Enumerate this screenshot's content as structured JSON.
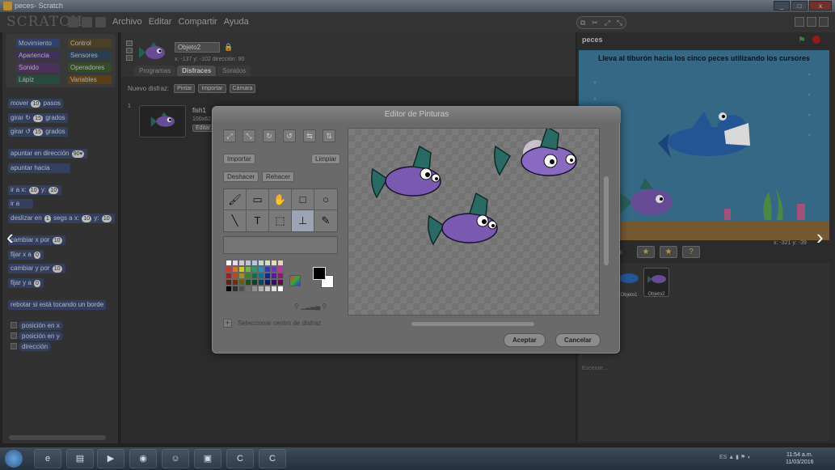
{
  "window": {
    "title": "peces- Scratch",
    "controls": [
      "_",
      "□",
      "x"
    ]
  },
  "menubar": {
    "logo": "SCRATCH",
    "menus": [
      "Archivo",
      "Editar",
      "Compartir",
      "Ayuda"
    ]
  },
  "categories": [
    "Movimiento",
    "Control",
    "Apariencia",
    "Sensores",
    "Sonido",
    "Operadores",
    "Lápiz",
    "Variables"
  ],
  "blocks": [
    {
      "pre": "mover",
      "n1": "10",
      "post": "pasos"
    },
    {
      "pre": "girar ↻",
      "n1": "15",
      "post": "grados"
    },
    {
      "pre": "girar ↺",
      "n1": "15",
      "post": "grados"
    },
    {
      "pre": "apuntar en dirección",
      "n1": "90▾",
      "post": ""
    },
    {
      "pre": "apuntar hacia",
      "n1": "",
      "post": ""
    },
    {
      "pre": "ir a x:",
      "n1": "10",
      "post": "y:",
      "n2": "10"
    },
    {
      "pre": "ir a",
      "n1": "",
      "post": ""
    },
    {
      "pre": "deslizar en",
      "n1": "1",
      "post": "segs a x:",
      "n2": "10",
      "post2": "y:",
      "n3": "10"
    },
    {
      "pre": "cambiar x por",
      "n1": "10",
      "post": ""
    },
    {
      "pre": "fijar x a",
      "n1": "0",
      "post": ""
    },
    {
      "pre": "cambiar y por",
      "n1": "10",
      "post": ""
    },
    {
      "pre": "fijar y a",
      "n1": "0",
      "post": ""
    },
    {
      "pre": "rebotar si está tocando un borde",
      "n1": "",
      "post": ""
    }
  ],
  "reporters": [
    "posición en x",
    "posición en y",
    "dirección"
  ],
  "sprite": {
    "name": "Objeto2",
    "pos": "x: -137  y: -102  dirección: 90"
  },
  "tabs": [
    "Programas",
    "Disfraces",
    "Sonidos"
  ],
  "costumes": {
    "new_label": "Nuevo disfraz:",
    "buttons": [
      "Pintar",
      "Importar",
      "Cámara"
    ],
    "index": "1",
    "name": "fish1",
    "dims": "100x62",
    "edit": "Editar"
  },
  "stage": {
    "project": "peces",
    "instruction": "Lleva al tiburón hacia los cinco peces utilizando los cursores",
    "coords": "x: -321  y: -39",
    "sprite_label": "to:",
    "sprites": [
      "Objeto1",
      "Objeto2"
    ],
    "stage_label": "Escenar..."
  },
  "paint_editor": {
    "title": "Editor de Pinturas",
    "import": "Importar",
    "clear": "Limpiar",
    "undo": "Deshacer",
    "redo": "Rehacer",
    "center_label": "Seleccionar centro de disfraz",
    "accept": "Aceptar",
    "cancel": "Cancelar",
    "top_tools": [
      "⤢",
      "⤡",
      "↻",
      "↺",
      "⇆",
      "⇅"
    ],
    "tools": [
      "🖌",
      "▭",
      "✋",
      "□",
      "○",
      "╲",
      "T",
      "⬚",
      "⊥",
      "✎"
    ],
    "palette": [
      "#ffffff",
      "#e8d8e8",
      "#d4c4dc",
      "#c0c0d8",
      "#b8c8d8",
      "#c0d8d0",
      "#d0e0c0",
      "#e0e0b8",
      "#e8d0c0",
      "#d83030",
      "#e07020",
      "#e0c020",
      "#60c030",
      "#20a060",
      "#2090c0",
      "#2040c0",
      "#7030c0",
      "#c030a0",
      "#a02020",
      "#b05020",
      "#a09020",
      "#408020",
      "#107040",
      "#107090",
      "#102890",
      "#502090",
      "#901870",
      "#602010",
      "#703010",
      "#606010",
      "#205010",
      "#104020",
      "#104060",
      "#101860",
      "#301060",
      "#600840",
      "#000000",
      "#303030",
      "#505050",
      "#707070",
      "#909090",
      "#b0b0b0",
      "#c8c8c8",
      "#e0e0e0",
      "#ffffff"
    ],
    "zoom": "⚲  ▁▂▃▄  ⚲"
  },
  "taskbar": {
    "tray": "ES  ▲ ▮ ⚑ ◖",
    "time": "11:54 a.m.",
    "date": "11/03/2016"
  }
}
